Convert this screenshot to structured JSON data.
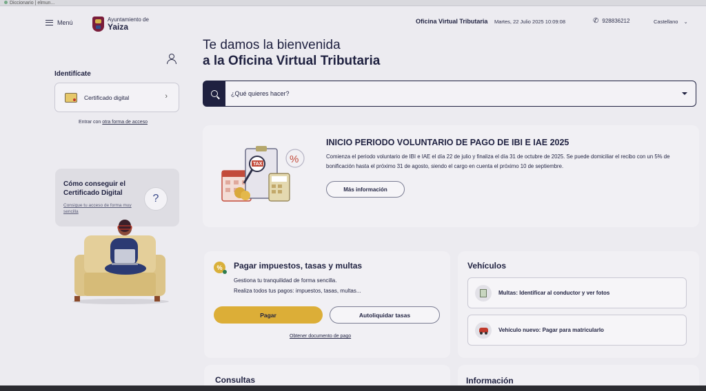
{
  "browser": {
    "tab1": "Diccionario | elmun..."
  },
  "header": {
    "menu_label": "Menú",
    "logo_small": "Ayuntamiento de",
    "logo_big": "Yaiza",
    "office_name": "Oficina Virtual Tributaria",
    "datetime": "Martes, 22 Julio 2025 10:09:08",
    "phone": "928836212",
    "language": "Castellano"
  },
  "sidebar": {
    "identify_title": "Identifícate",
    "cert_label": "Certificado digital",
    "other_access_prefix": "Entrar con ",
    "other_access_link": "otra forma de acceso",
    "howto_title": "Cómo conseguir el Certificado Digital",
    "howto_link": "Consigue tu acceso de forma muy sencilla"
  },
  "main": {
    "welcome_line1": "Te damos la bienvenida",
    "welcome_line2": "a la Oficina Virtual Tributaria",
    "search_placeholder": "¿Qué quieres hacer?",
    "banner": {
      "tax_tag": "TAX",
      "title": "INICIO PERIODO VOLUNTARIO DE PAGO DE IBI E IAE 2025",
      "text": "Comienza el periodo voluntario de IBI e IAE el día 22 de julio y finaliza el día 31 de octubre de 2025. Se puede domiciliar el recibo con un 5% de bonificación hasta el próximo 31 de agosto, siendo el cargo en cuenta el próximo 10 de septiembre.",
      "button": "Más información"
    },
    "pay": {
      "title": "Pagar impuestos, tasas y multas",
      "desc1": "Gestiona tu tranquilidad de forma sencilla.",
      "desc2": "Realiza todos tus pagos: impuestos, tasas, multas...",
      "pay_button": "Pagar",
      "self_button": "Autoliquidar tasas",
      "doc_link": "Obtener documento de pago"
    },
    "vehicles": {
      "title": "Vehículos",
      "item1": "Multas: Identificar al conductor y ver fotos",
      "item2": "Vehículo nuevo: Pagar para matricularlo"
    },
    "consultas_title": "Consultas",
    "info_title": "Información"
  }
}
